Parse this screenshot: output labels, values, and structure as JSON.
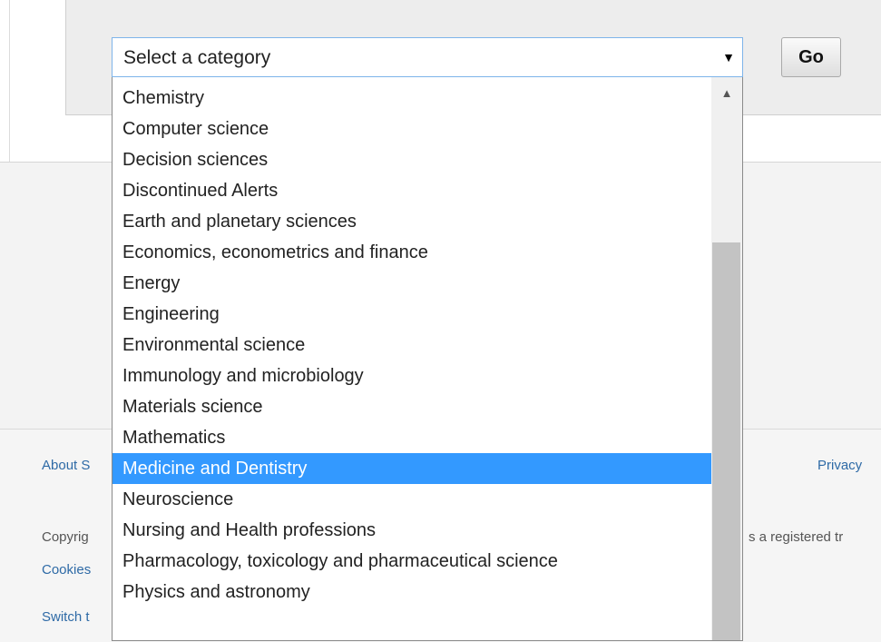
{
  "select": {
    "value": "Select a category",
    "arrow_icon": "▼"
  },
  "go_button": "Go",
  "dropdown": {
    "options": [
      "Chemistry",
      "Computer science",
      "Decision sciences",
      "Discontinued Alerts",
      "Earth and planetary sciences",
      "Economics, econometrics and finance",
      "Energy",
      "Engineering",
      "Environmental science",
      "Immunology and microbiology",
      "Materials science",
      "Mathematics",
      "Medicine and Dentistry",
      "Neuroscience",
      "Nursing and Health professions",
      "Pharmacology, toxicology and pharmaceutical science",
      "Physics and astronomy"
    ],
    "selected": "Medicine and Dentistry",
    "scroll_up_icon": "▲"
  },
  "footer": {
    "about": "About S",
    "privacy": "Privacy",
    "copyright": "Copyrig",
    "registered": "s a registered tr",
    "cookies": "Cookies",
    "switch": "Switch t"
  }
}
